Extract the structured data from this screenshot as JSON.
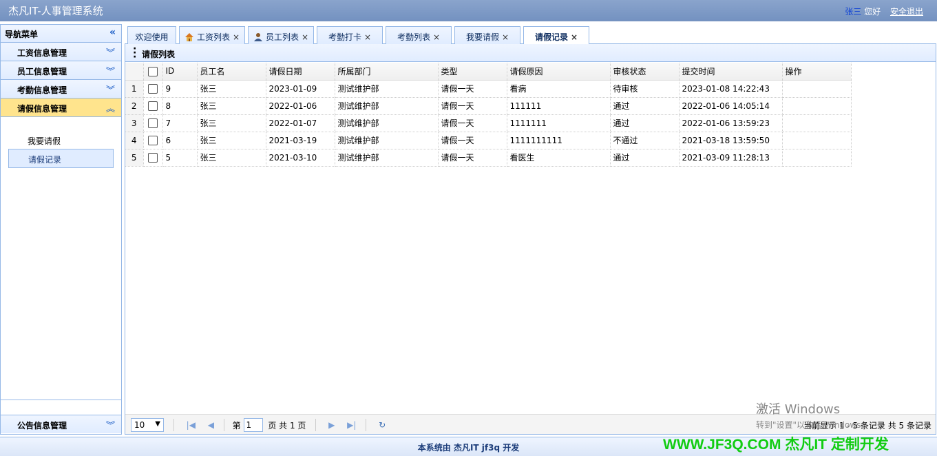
{
  "header": {
    "title": "杰凡IT-人事管理系统",
    "user_name": "张三",
    "greeting": "您好",
    "logout": "安全退出"
  },
  "sidebar": {
    "title": "导航菜单",
    "groups": [
      {
        "label": "工资信息管理"
      },
      {
        "label": "员工信息管理"
      },
      {
        "label": "考勤信息管理"
      },
      {
        "label": "请假信息管理"
      }
    ],
    "sub_items": [
      {
        "label": "我要请假"
      },
      {
        "label": "请假记录"
      }
    ],
    "bottom_group": {
      "label": "公告信息管理"
    }
  },
  "tabs": [
    {
      "label": "欢迎使用",
      "closable": false
    },
    {
      "label": "工资列表",
      "icon": "home-icon"
    },
    {
      "label": "员工列表",
      "icon": "user-icon"
    },
    {
      "label": "考勤打卡"
    },
    {
      "label": "考勤列表"
    },
    {
      "label": "我要请假"
    },
    {
      "label": "请假记录",
      "active": true
    }
  ],
  "panel": {
    "title": "请假列表"
  },
  "grid": {
    "columns": [
      "ID",
      "员工名",
      "请假日期",
      "所属部门",
      "类型",
      "请假原因",
      "审核状态",
      "提交时间",
      "操作"
    ],
    "rows": [
      {
        "rn": "1",
        "id": "9",
        "name": "张三",
        "date": "2023-01-09",
        "dept": "测试维护部",
        "type": "请假一天",
        "reason": "看病",
        "status": "待审核",
        "time": "2023-01-08 14:22:43"
      },
      {
        "rn": "2",
        "id": "8",
        "name": "张三",
        "date": "2022-01-06",
        "dept": "测试维护部",
        "type": "请假一天",
        "reason": "111111",
        "status": "通过",
        "time": "2022-01-06 14:05:14"
      },
      {
        "rn": "3",
        "id": "7",
        "name": "张三",
        "date": "2022-01-07",
        "dept": "测试维护部",
        "type": "请假一天",
        "reason": "1111111",
        "status": "通过",
        "time": "2022-01-06 13:59:23"
      },
      {
        "rn": "4",
        "id": "6",
        "name": "张三",
        "date": "2021-03-19",
        "dept": "测试维护部",
        "type": "请假一天",
        "reason": "1111111111",
        "status": "不通过",
        "time": "2021-03-18 13:59:50"
      },
      {
        "rn": "5",
        "id": "5",
        "name": "张三",
        "date": "2021-03-10",
        "dept": "测试维护部",
        "type": "请假一天",
        "reason": "看医生",
        "status": "通过",
        "time": "2021-03-09 11:28:13"
      }
    ]
  },
  "pager": {
    "page_size": "10",
    "page_prefix": "第",
    "page_value": "1",
    "page_suffix": "页 共 1 页",
    "summary": "当前显示 1 - 5 条记录 共 5 条记录"
  },
  "footer": {
    "text": "本系统由 杰凡IT jf3q 开发"
  },
  "brand": "WWW.JF3Q.COM 杰凡IT  定制开发",
  "activation": {
    "line1": "激活 Windows",
    "line2": "转到\"设置\"以激活 Windows。"
  }
}
